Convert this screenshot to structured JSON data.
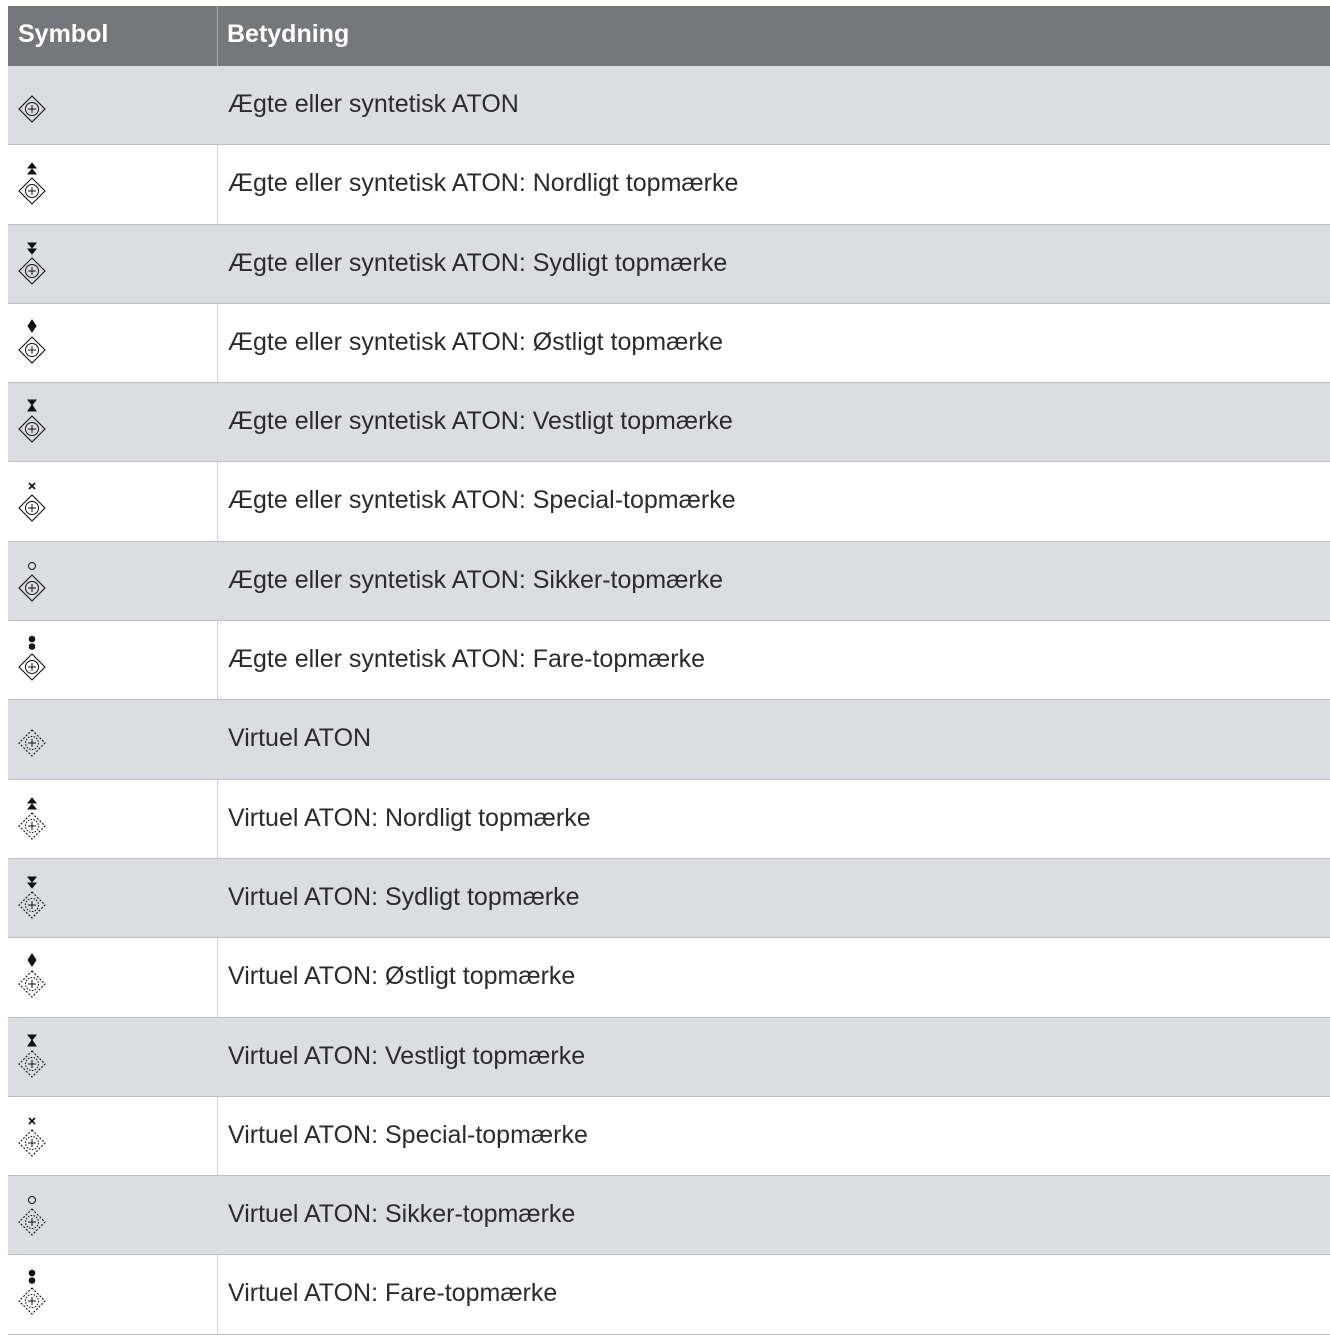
{
  "header": {
    "col_symbol": "Symbol",
    "col_meaning": "Betydning"
  },
  "rows": [
    {
      "icon": "real-aton-icon",
      "topmark": "none",
      "virtual": false,
      "label": "Ægte eller syntetisk ATON"
    },
    {
      "icon": "real-aton-north-topmark-icon",
      "topmark": "north",
      "virtual": false,
      "label": "Ægte eller syntetisk ATON: Nordligt topmærke"
    },
    {
      "icon": "real-aton-south-topmark-icon",
      "topmark": "south",
      "virtual": false,
      "label": "Ægte eller syntetisk ATON: Sydligt topmærke"
    },
    {
      "icon": "real-aton-east-topmark-icon",
      "topmark": "east",
      "virtual": false,
      "label": "Ægte eller syntetisk ATON: Østligt topmærke"
    },
    {
      "icon": "real-aton-west-topmark-icon",
      "topmark": "west",
      "virtual": false,
      "label": "Ægte eller syntetisk ATON: Vestligt topmærke"
    },
    {
      "icon": "real-aton-special-topmark-icon",
      "topmark": "special",
      "virtual": false,
      "label": "Ægte eller syntetisk ATON: Special-topmærke"
    },
    {
      "icon": "real-aton-safe-topmark-icon",
      "topmark": "safe",
      "virtual": false,
      "label": "Ægte eller syntetisk ATON: Sikker-topmærke"
    },
    {
      "icon": "real-aton-danger-topmark-icon",
      "topmark": "danger",
      "virtual": false,
      "label": "Ægte eller syntetisk ATON: Fare-topmærke"
    },
    {
      "icon": "virtual-aton-icon",
      "topmark": "none",
      "virtual": true,
      "label": "Virtuel ATON"
    },
    {
      "icon": "virtual-aton-north-topmark-icon",
      "topmark": "north",
      "virtual": true,
      "label": "Virtuel ATON: Nordligt topmærke"
    },
    {
      "icon": "virtual-aton-south-topmark-icon",
      "topmark": "south",
      "virtual": true,
      "label": "Virtuel ATON: Sydligt topmærke"
    },
    {
      "icon": "virtual-aton-east-topmark-icon",
      "topmark": "east",
      "virtual": true,
      "label": "Virtuel ATON: Østligt topmærke"
    },
    {
      "icon": "virtual-aton-west-topmark-icon",
      "topmark": "west",
      "virtual": true,
      "label": "Virtuel ATON: Vestligt topmærke"
    },
    {
      "icon": "virtual-aton-special-topmark-icon",
      "topmark": "special",
      "virtual": true,
      "label": "Virtuel ATON: Special-topmærke"
    },
    {
      "icon": "virtual-aton-safe-topmark-icon",
      "topmark": "safe",
      "virtual": true,
      "label": "Virtuel ATON: Sikker-topmærke"
    },
    {
      "icon": "virtual-aton-danger-topmark-icon",
      "topmark": "danger",
      "virtual": true,
      "label": "Virtuel ATON: Fare-topmærke"
    }
  ]
}
